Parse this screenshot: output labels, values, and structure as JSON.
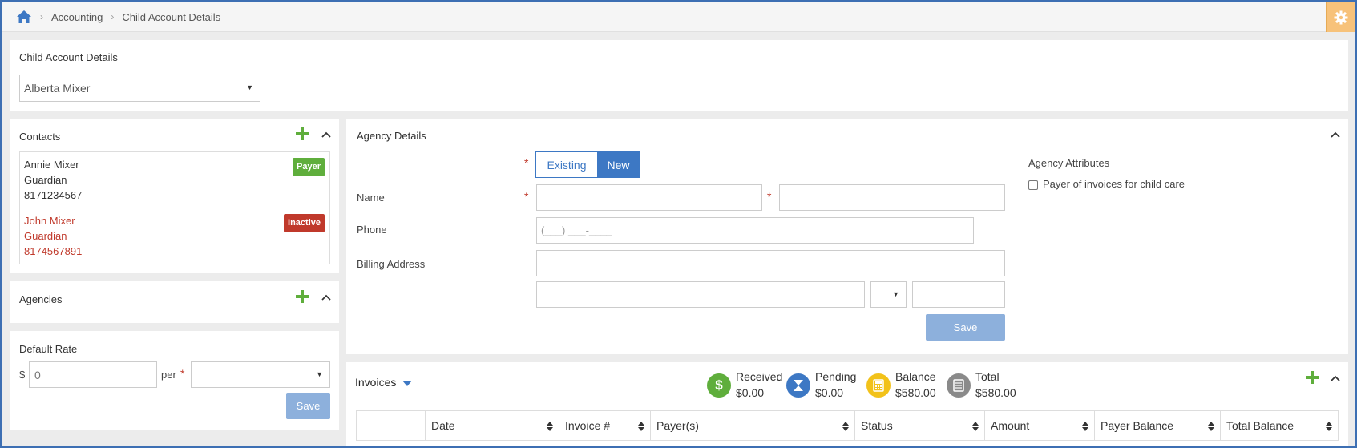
{
  "breadcrumb": {
    "items": [
      "Accounting",
      "Child Account Details"
    ]
  },
  "child": {
    "title": "Child Account Details",
    "selected": "Alberta Mixer"
  },
  "contacts": {
    "title": "Contacts",
    "items": [
      {
        "name": "Annie Mixer",
        "role": "Guardian",
        "phone": "8171234567",
        "badge": "Payer"
      },
      {
        "name": "John Mixer",
        "role": "Guardian",
        "phone": "8174567891",
        "badge": "Inactive"
      }
    ]
  },
  "agencies": {
    "title": "Agencies"
  },
  "rate": {
    "title": "Default Rate",
    "currency": "$",
    "value": "0",
    "per": "per",
    "save": "Save"
  },
  "agency": {
    "title": "Agency Details",
    "toggle": [
      "Existing",
      "New"
    ],
    "labels": {
      "name": "Name",
      "phone": "Phone",
      "billing": "Billing Address"
    },
    "phone_placeholder": "(___) ___-____",
    "save": "Save",
    "attributes_title": "Agency Attributes",
    "payer_checkbox": "Payer of invoices for child care"
  },
  "invoices": {
    "title": "Invoices",
    "stats": [
      {
        "label": "Received",
        "value": "$0.00",
        "color": "#5fae3c",
        "icon": "dollar-icon"
      },
      {
        "label": "Pending",
        "value": "$0.00",
        "color": "#3d78c4",
        "icon": "hourglass-icon"
      },
      {
        "label": "Balance",
        "value": "$580.00",
        "color": "#f2c21a",
        "icon": "calculator-icon"
      },
      {
        "label": "Total",
        "value": "$580.00",
        "color": "#8a8a8a",
        "icon": "ledger-icon"
      }
    ],
    "columns": [
      "",
      "Date",
      "Invoice #",
      "Payer(s)",
      "Status",
      "Amount",
      "Payer Balance",
      "Total Balance"
    ]
  },
  "colors": {
    "accent": "#3d78c4",
    "green": "#5fae3c",
    "danger": "#c0392b",
    "gear": "#f7c27a"
  }
}
